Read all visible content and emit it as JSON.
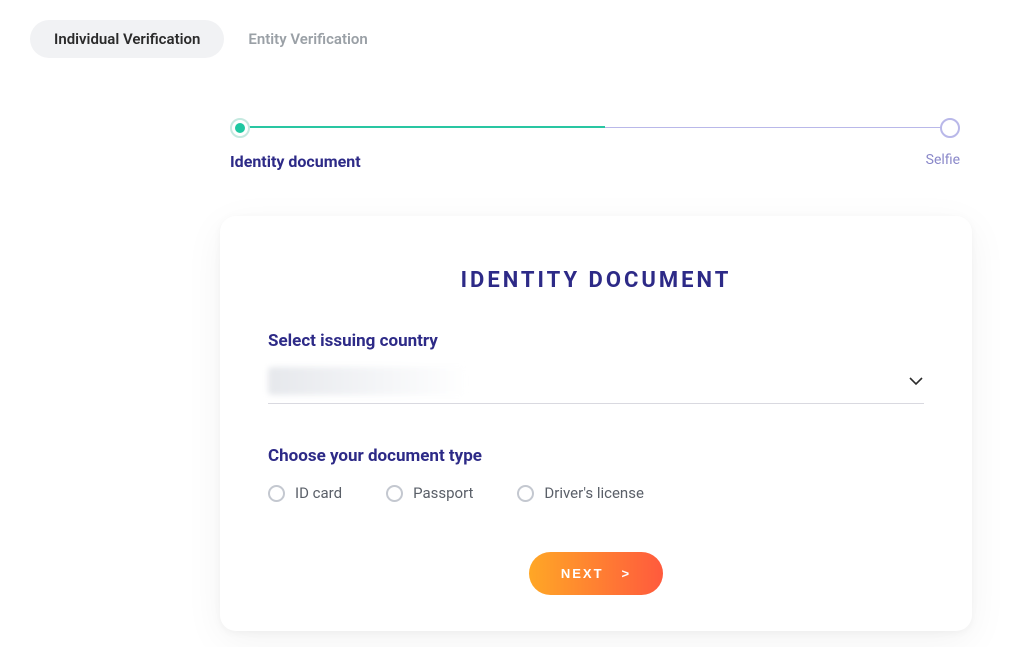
{
  "tabs": {
    "individual": "Individual Verification",
    "entity": "Entity Verification"
  },
  "stepper": {
    "step1_label": "Identity document",
    "step2_label": "Selfie"
  },
  "card": {
    "title": "IDENTITY DOCUMENT",
    "country_label": "Select issuing country",
    "country_value": "",
    "doc_label": "Choose your document type",
    "options": {
      "id_card": "ID card",
      "passport": "Passport",
      "drivers_license": "Driver's license"
    },
    "next_label": "NEXT",
    "next_arrow": ">"
  },
  "colors": {
    "accent_primary": "#2d2a87",
    "accent_teal": "#1fc7a1",
    "button_gradient_from": "#ffa726",
    "button_gradient_to": "#ff5a3d"
  }
}
